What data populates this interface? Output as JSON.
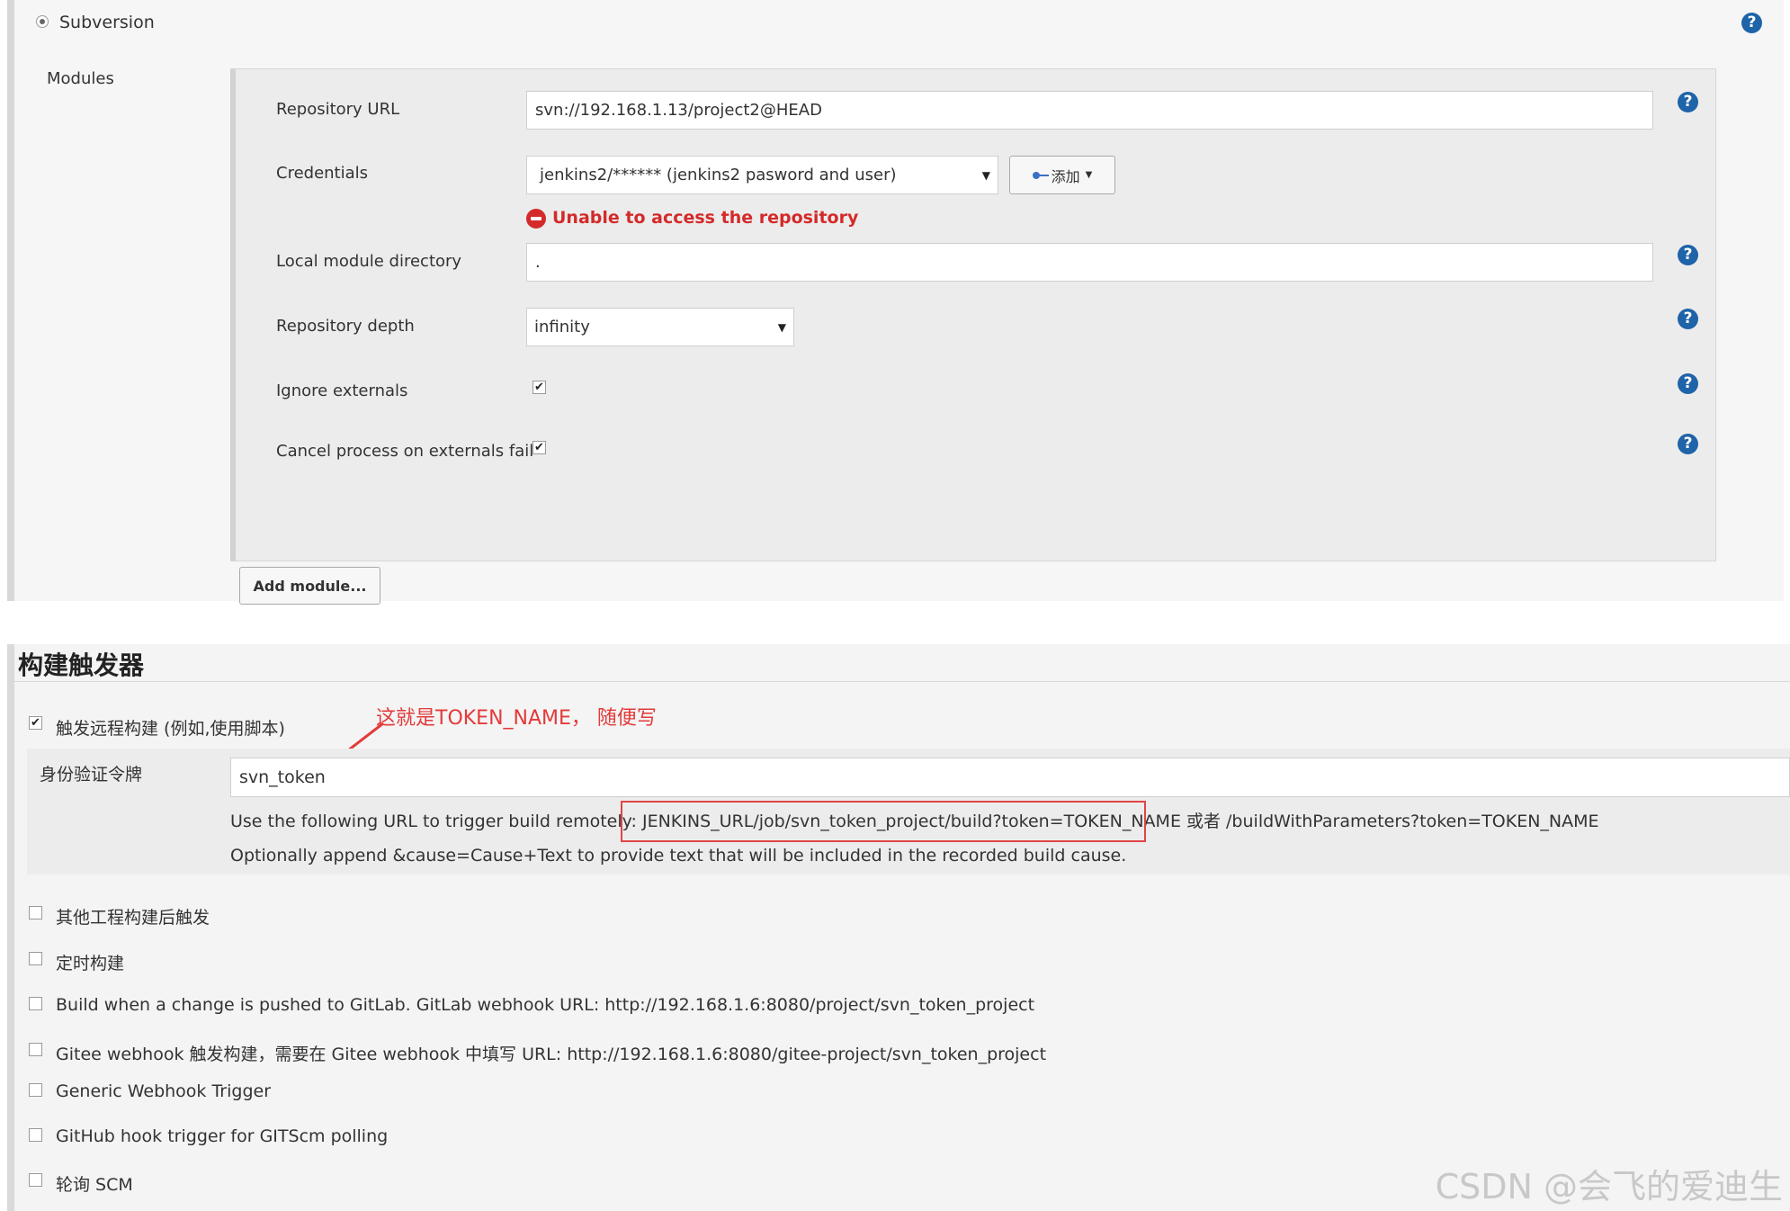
{
  "scm": {
    "option_label": "Subversion",
    "modules_label": "Modules",
    "repo_url_label": "Repository URL",
    "repo_url_value": "svn://192.168.1.13/project2@HEAD",
    "credentials_label": "Credentials",
    "credentials_value": "jenkins2/****** (jenkins2 pasword and user)",
    "add_button_label": "添加",
    "error_text": "Unable to access the repository",
    "local_dir_label": "Local module directory",
    "local_dir_value": ".",
    "depth_label": "Repository depth",
    "depth_value": "infinity",
    "ignore_externals_label": "Ignore externals",
    "ignore_externals_checked": true,
    "cancel_process_label": "Cancel process on externals fail",
    "cancel_process_checked": true,
    "add_module_label": "Add module..."
  },
  "triggers": {
    "section_title": "构建触发器",
    "remote_build_label": "触发远程构建 (例如,使用脚本)",
    "remote_build_checked": true,
    "annotation": "这就是TOKEN_NAME， 随便写",
    "token_label": "身份验证令牌",
    "token_value": "svn_token",
    "url_hint_prefix": "Use the following URL to trigger build remotely: ",
    "url_hint_url": "JENKINS_URL/job/svn_token_project/build?token=TOKEN_NAME",
    "url_hint_suffix": " 或者 /buildWithParameters?token=TOKEN_NAME",
    "cause_hint": "Optionally append &cause=Cause+Text to provide text that will be included in the recorded build cause.",
    "options": [
      {
        "label": "其他工程构建后触发",
        "checked": false
      },
      {
        "label": "定时构建",
        "checked": false
      },
      {
        "label": "Build when a change is pushed to GitLab. GitLab webhook URL: http://192.168.1.6:8080/project/svn_token_project",
        "checked": false
      },
      {
        "label": "Gitee webhook 触发构建，需要在 Gitee webhook 中填写 URL: http://192.168.1.6:8080/gitee-project/svn_token_project",
        "checked": false
      },
      {
        "label": "Generic Webhook Trigger",
        "checked": false
      },
      {
        "label": "GitHub hook trigger for GITScm polling",
        "checked": false
      },
      {
        "label": "轮询 SCM",
        "checked": false
      }
    ]
  },
  "help_icon_glyph": "?",
  "watermark": "CSDN @会飞的爱迪生",
  "colors": {
    "help_icon": "#1f63a8",
    "error": "#d42a2a",
    "annotation": "#e33a3a"
  }
}
